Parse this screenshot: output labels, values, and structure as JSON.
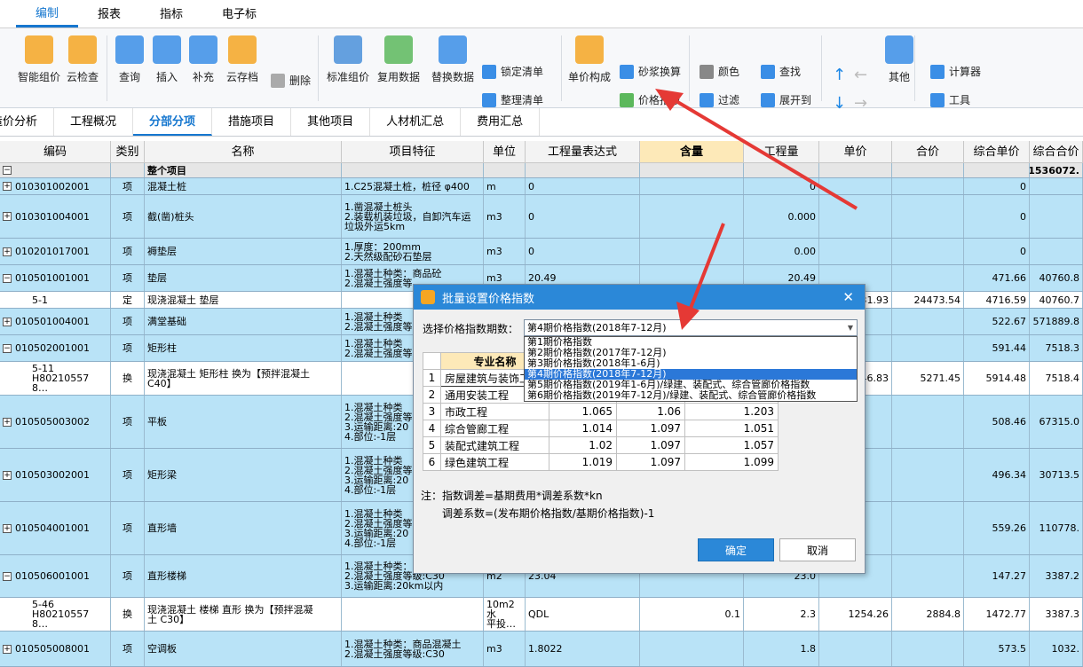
{
  "menu": [
    "编制",
    "报表",
    "指标",
    "电子标"
  ],
  "ribbon": {
    "big": [
      "智能组价",
      "云检查",
      "查询",
      "插入",
      "补充",
      "云存档",
      "标准组价",
      "复用数据",
      "替换数据",
      "单价构成",
      "其他"
    ],
    "delete": "删除",
    "lock": "锁定清单",
    "organize": "整理清单",
    "mortar": "砂浆换算",
    "price_index": "价格指数",
    "color": "颜色",
    "find": "查找",
    "filter": "过滤",
    "expand": "展开到",
    "calculator": "计算器",
    "tools": "工具"
  },
  "tabs": [
    "造价分析",
    "工程概况",
    "分部分项",
    "措施项目",
    "其他项目",
    "人材机汇总",
    "费用汇总"
  ],
  "columns": [
    "编码",
    "类别",
    "名称",
    "项目特征",
    "单位",
    "工程量表达式",
    "含量",
    "工程量",
    "单价",
    "合价",
    "综合单价",
    "综合合价"
  ],
  "rows": [
    {
      "t": "gray",
      "h": 17,
      "pm": "−",
      "c": [
        "",
        "",
        "整个项目",
        "",
        "",
        "",
        "",
        "",
        "",
        "",
        "",
        "1536072."
      ]
    },
    {
      "t": "blue",
      "h": 19,
      "pm": "+",
      "c": [
        "010301002001",
        "项",
        "混凝土桩",
        "1.C25混凝土桩，桩径 φ400",
        "m",
        "0",
        "",
        "0",
        "",
        "",
        "0",
        ""
      ]
    },
    {
      "t": "blue",
      "h": 49,
      "pm": "+",
      "c": [
        "010301004001",
        "项",
        "截(凿)桩头",
        "1.凿混凝土桩头\n2.装载机装垃圾，自卸汽车运\n垃圾外运5km",
        "m3",
        "0",
        "",
        "0.000",
        "",
        "",
        "0",
        ""
      ]
    },
    {
      "t": "blue",
      "h": 30,
      "pm": "+",
      "c": [
        "010201017001",
        "项",
        "褥垫层",
        "1.厚度：200mm\n2.天然级配砂石垫层",
        "m3",
        "0",
        "",
        "0.00",
        "",
        "",
        "0",
        ""
      ]
    },
    {
      "t": "blue",
      "h": 30,
      "pm": "−",
      "c": [
        "010501001001",
        "项",
        "垫层",
        "1.混凝土种类：商品砼\n2.混凝土强度等",
        "m3",
        "20.49",
        "",
        "20.49",
        "",
        "",
        "471.66",
        "40760.8"
      ]
    },
    {
      "t": "white",
      "h": 19,
      "pm": "",
      "c": [
        "5-1",
        "定",
        "现浇混凝土 垫层",
        "",
        "",
        "",
        "",
        "",
        "1131.93",
        "24473.54",
        "4716.59",
        "40760.7"
      ]
    },
    {
      "t": "blue",
      "h": 30,
      "pm": "+",
      "c": [
        "010501004001",
        "项",
        "满堂基础",
        "1.混凝土种类\n2.混凝土强度等",
        "",
        "",
        "",
        "",
        "",
        "",
        "522.67",
        "571889.8"
      ]
    },
    {
      "t": "blue",
      "h": 30,
      "pm": "−",
      "c": [
        "010502001001",
        "项",
        "矩形柱",
        "1.混凝土种类\n2.混凝土强度等",
        "",
        "",
        "",
        "",
        "",
        "",
        "591.44",
        "7518.3"
      ]
    },
    {
      "t": "white",
      "h": 38,
      "pm": "",
      "c": [
        "5-11\nH80210557 8…",
        "换",
        "现浇混凝土 矩形柱  换为【预拌混凝土\nC40】",
        "",
        "",
        "",
        "",
        "",
        "1446.83",
        "5271.45",
        "5914.48",
        "7518.4"
      ]
    },
    {
      "t": "blue",
      "h": 60,
      "pm": "+",
      "c": [
        "010505003002",
        "项",
        "平板",
        "1.混凝土种类\n2.混凝土强度等\n3.运输距离:20\n4.部位:-1层",
        "",
        "",
        "",
        "",
        "",
        "",
        "508.46",
        "67315.0"
      ]
    },
    {
      "t": "blue",
      "h": 60,
      "pm": "+",
      "c": [
        "010503002001",
        "项",
        "矩形梁",
        "1.混凝土种类\n2.混凝土强度等\n3.运输距离:20\n4.部位:-1层",
        "",
        "",
        "",
        "",
        "",
        "",
        "496.34",
        "30713.5"
      ]
    },
    {
      "t": "blue",
      "h": 60,
      "pm": "+",
      "c": [
        "010504001001",
        "项",
        "直形墙",
        "1.混凝土种类\n2.混凝土强度等\n3.运输距离:20\n4.部位:-1层",
        "",
        "",
        "",
        "",
        "",
        "",
        "559.26",
        "110778."
      ]
    },
    {
      "t": "blue",
      "h": 48,
      "pm": "−",
      "c": [
        "010506001001",
        "项",
        "直形楼梯",
        "1.混凝土种类：商品砼\n2.混凝土强度等级:C30\n3.运输距离:20km以内",
        "m2",
        "23.04",
        "",
        "23.0",
        "",
        "",
        "147.27",
        "3387.2"
      ]
    },
    {
      "t": "white",
      "h": 38,
      "pm": "",
      "c": [
        "5-46\nH80210557 8…",
        "换",
        "现浇混凝土 楼梯 直形  换为【预拌混凝\n土 C30】",
        "",
        "10m2水\n平投…",
        "QDL",
        "0.1",
        "2.3",
        "1254.26",
        "2884.8",
        "1472.77",
        "3387.3"
      ]
    },
    {
      "t": "blue",
      "h": 40,
      "pm": "+",
      "c": [
        "010505008001",
        "项",
        "空调板",
        "1.混凝土种类：商品混凝土\n2.混凝土强度等级:C30",
        "m3",
        "1.8022",
        "",
        "1.8",
        "",
        "",
        "573.5",
        "1032."
      ]
    }
  ],
  "dialog": {
    "title": "批量设置价格指数",
    "label": "选择价格指数期数：",
    "selected": "第4期价格指数(2018年7-12月)",
    "options": [
      "第1期价格指数",
      "第2期价格指数(2017年7-12月)",
      "第3期价格指数(2018年1-6月)",
      "第4期价格指数(2018年7-12月)",
      "第5期价格指数(2019年1-6月)/绿建、装配式、综合管廊价格指数",
      "第6期价格指数(2019年7-12月)/绿建、装配式、综合管廊价格指数"
    ],
    "table_header": "专业名称",
    "table_rows": [
      {
        "n": "1",
        "name": "房屋建筑与装饰工",
        "v": [
          "",
          "",
          ""
        ]
      },
      {
        "n": "2",
        "name": "通用安装工程",
        "v": [
          "",
          "",
          ""
        ]
      },
      {
        "n": "3",
        "name": "市政工程",
        "v": [
          "1.065",
          "1.06",
          "1.203"
        ]
      },
      {
        "n": "4",
        "name": "综合管廊工程",
        "v": [
          "1.014",
          "1.097",
          "1.051"
        ]
      },
      {
        "n": "5",
        "name": "装配式建筑工程",
        "v": [
          "1.02",
          "1.097",
          "1.057"
        ]
      },
      {
        "n": "6",
        "name": "绿色建筑工程",
        "v": [
          "1.019",
          "1.097",
          "1.099"
        ]
      }
    ],
    "note1": "注：指数调差=基期费用*调差系数*kn",
    "note2": "调差系数=(发布期价格指数/基期价格指数)-1",
    "ok": "确定",
    "cancel": "取消"
  }
}
